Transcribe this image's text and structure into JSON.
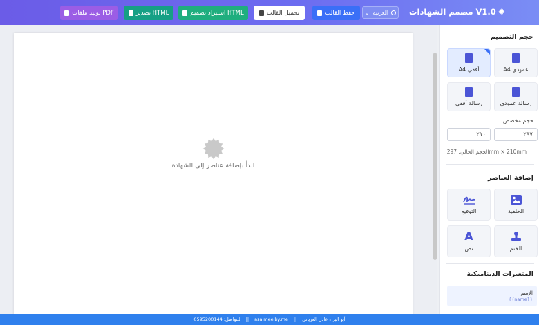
{
  "header": {
    "title": "مصمم الشهادات V1.0",
    "language": "العربية",
    "buttons": {
      "generate_pdf": "توليد ملفات PDF",
      "export_html": "تصدير HTML",
      "import_html": "استيراد تصميم HTML",
      "load_template": "تحميل القالب",
      "save_template": "حفظ القالب"
    }
  },
  "canvas": {
    "placeholder": "ابدأ بإضافة عناصر إلى الشهادة"
  },
  "panel": {
    "design_size": {
      "title": "حجم التصميم",
      "options": [
        {
          "label": "A4 عمودي",
          "active": false
        },
        {
          "label": "A4 أفقي",
          "active": true
        },
        {
          "label": "رسالة عمودي",
          "active": false
        },
        {
          "label": "رسالة أفقي",
          "active": false
        }
      ],
      "custom_label": "حجم مخصص",
      "width_value": "٢٩٧",
      "height_value": "٢١٠",
      "current_size": "الحجم الحالي: 297mm × 210mm"
    },
    "add_elements": {
      "title": "إضافة العناصر",
      "items": [
        {
          "label": "الخلفية",
          "icon": "image-icon"
        },
        {
          "label": "التوقيع",
          "icon": "signature-icon"
        },
        {
          "label": "الختم",
          "icon": "stamp-icon"
        },
        {
          "label": "نص",
          "icon": "text-icon"
        }
      ]
    },
    "variables": {
      "title": "المتغيرات الديناميكية",
      "items": [
        {
          "name": "الإسم",
          "code": "{{name}}"
        }
      ]
    }
  },
  "footer": {
    "author": "أبو البراء عادل العرياني",
    "website": "asalmeelby.me",
    "contact": "للتواصل: 0595200144"
  },
  "colors": {
    "header_start": "#6b5ce7",
    "accent": "#4b55d6",
    "footer": "#2f80ed"
  }
}
